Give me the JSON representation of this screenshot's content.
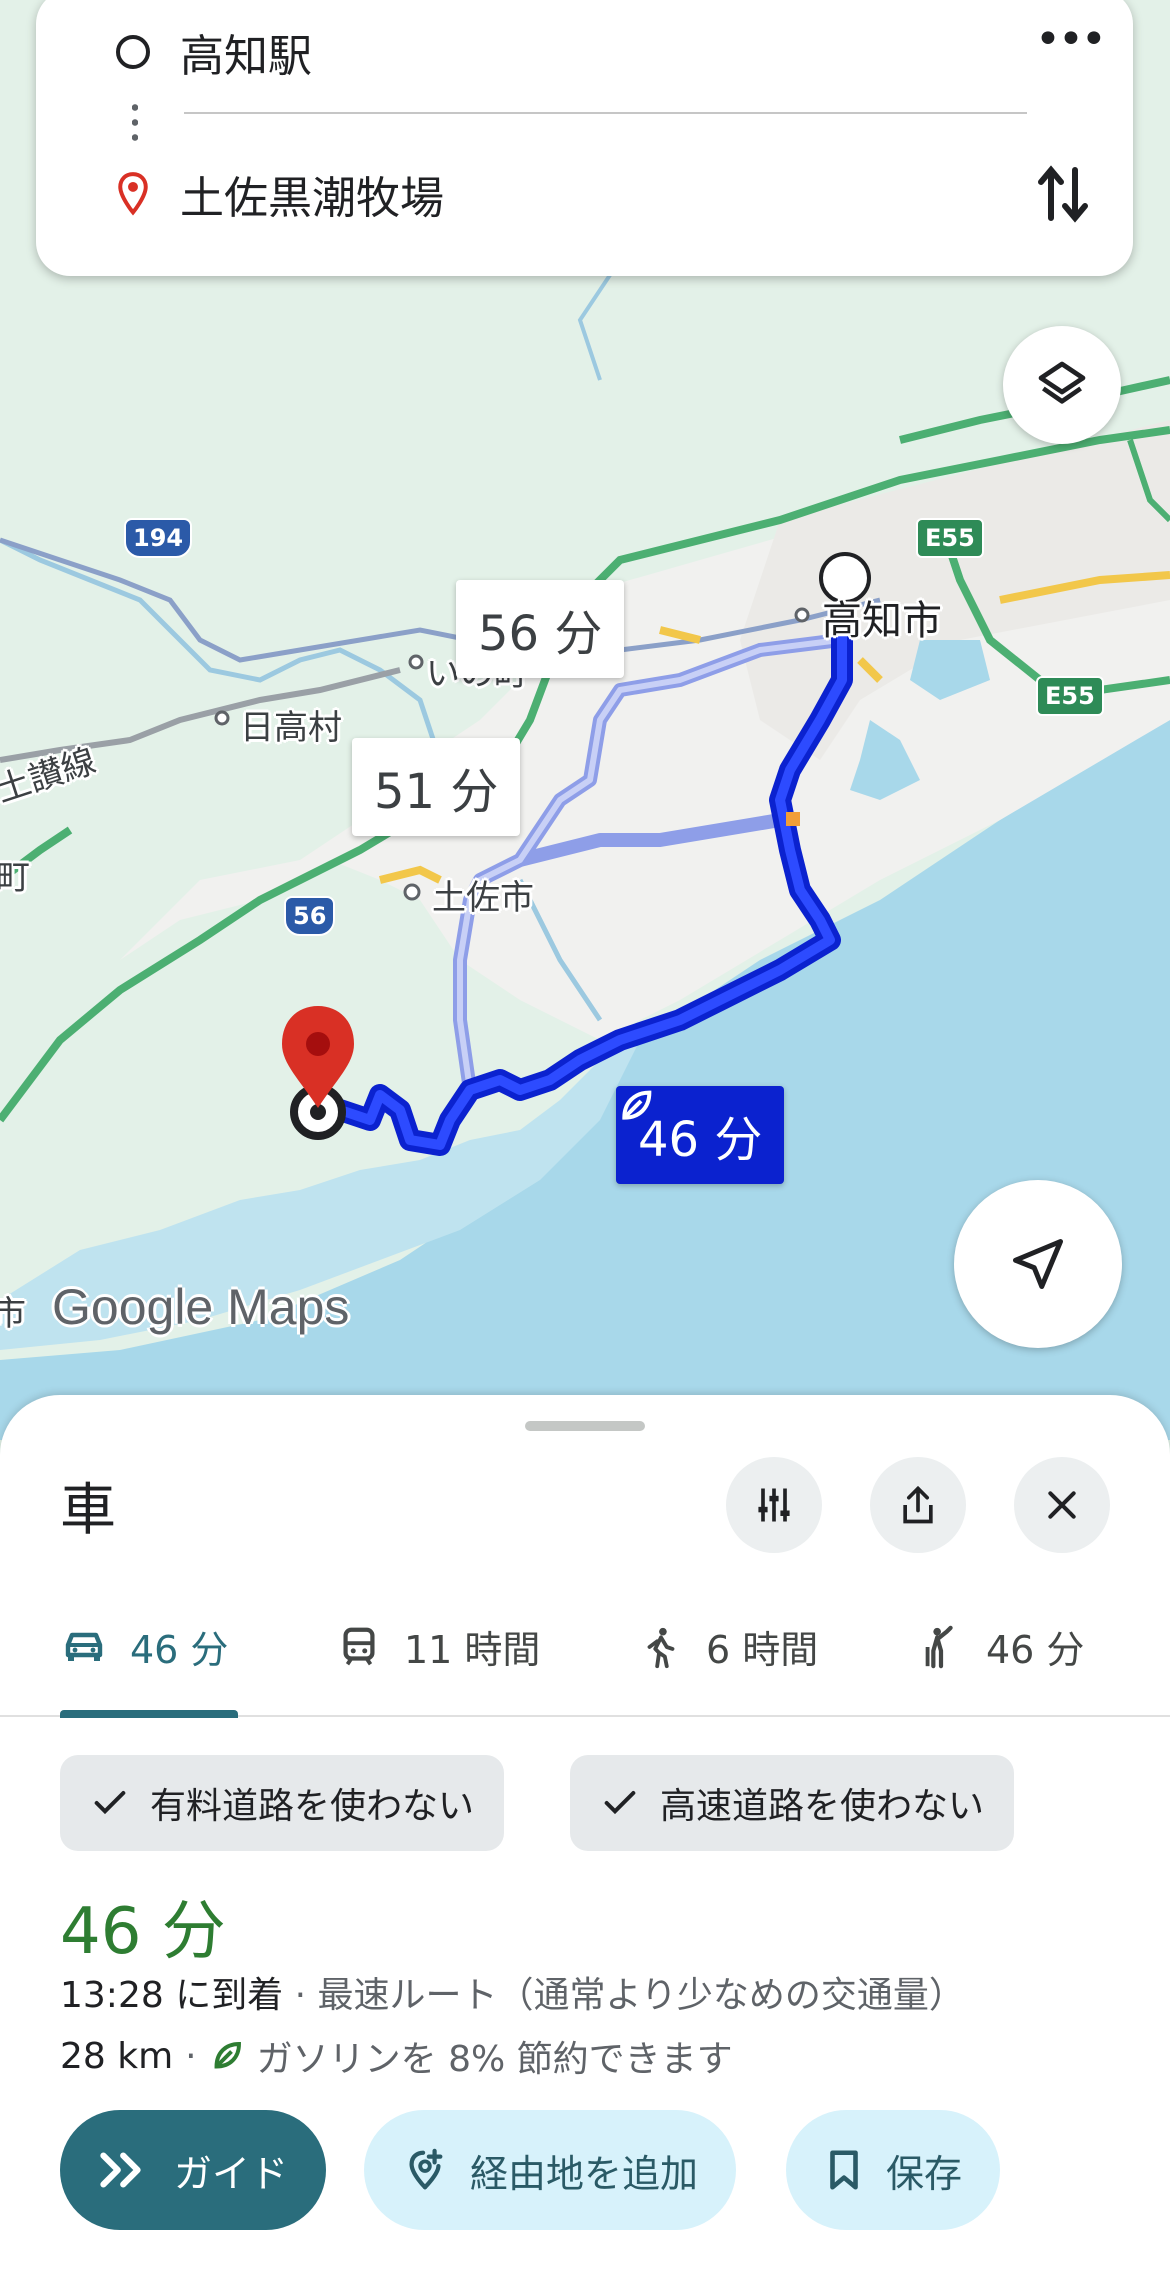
{
  "route": {
    "origin": "高知駅",
    "destination": "土佐黒潮牧場"
  },
  "map": {
    "labels": {
      "kochi_city": "高知市",
      "tosa_city": "土佐市",
      "hidaka_village": "日高村",
      "ino_town": "いの町",
      "dosan_line": "土讃線",
      "town_edge": "町",
      "city_edge": "市"
    },
    "shields": {
      "route_194": "194",
      "route_56": "56",
      "e55_top": "E55",
      "e55_bottom": "E55"
    },
    "route_bubbles": {
      "alt1": "56 分",
      "alt2": "51 分",
      "best": "46 分"
    },
    "watermark_google": "Google",
    "watermark_maps": "Maps"
  },
  "sheet": {
    "title": "車",
    "modes": [
      {
        "icon": "car-icon",
        "label": "46 分"
      },
      {
        "icon": "train-icon",
        "label": "11 時間"
      },
      {
        "icon": "walk-icon",
        "label": "6 時間"
      },
      {
        "icon": "ride-hail-icon",
        "label": "46 分"
      }
    ],
    "chips": [
      "有料道路を使わない",
      "高速道路を使わない"
    ],
    "duration": "46 分",
    "arrival": "13:28 に到着",
    "arrival_note": "· 最速ルート（通常より少なめの交通量）",
    "distance": "28 km",
    "fuel_note": "ガソリンを 8% 節約できます",
    "actions": {
      "guide": "ガイド",
      "add_stop": "経由地を追加",
      "save": "保存"
    }
  },
  "colors": {
    "accent": "#2a6d7c",
    "route_active": "#0b22cf",
    "duration_green": "#2e7d32"
  }
}
